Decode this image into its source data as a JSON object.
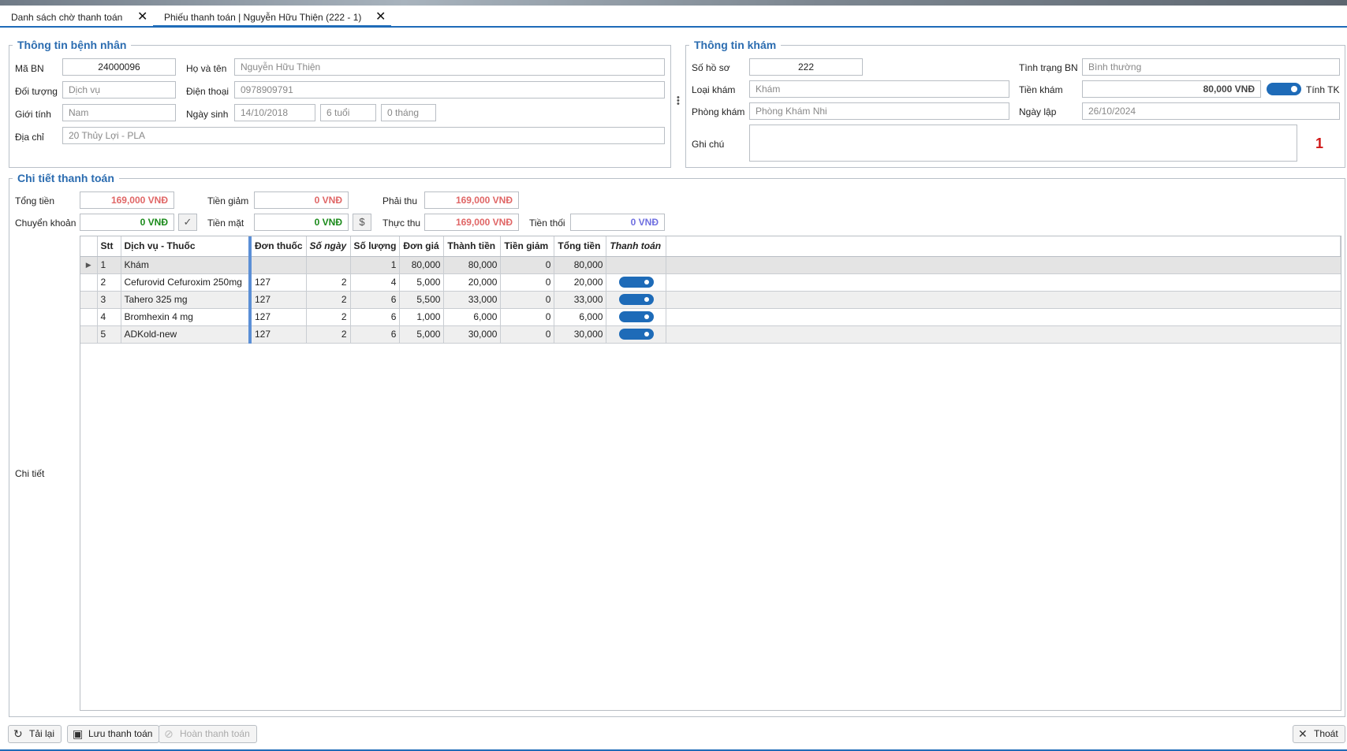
{
  "tabs": [
    {
      "label": "Danh sách chờ thanh toán",
      "close": "✕"
    },
    {
      "label": "Phiếu thanh toán | Nguyễn Hữu Thiện (222 - 1)",
      "close": "✕"
    }
  ],
  "patient": {
    "legend": "Thông tin bệnh nhân",
    "ma_bn_label": "Mã BN",
    "ma_bn": "24000096",
    "ho_ten_label": "Họ và tên",
    "ho_ten": "Nguyễn Hữu Thiện",
    "doi_tuong_label": "Đối tượng",
    "doi_tuong": "Dịch vụ",
    "dien_thoai_label": "Điện thoại",
    "dien_thoai": "0978909791",
    "gioi_tinh_label": "Giới tính",
    "gioi_tinh": "Nam",
    "ngay_sinh_label": "Ngày sinh",
    "ngay_sinh": "14/10/2018",
    "tuoi": "6 tuổi",
    "thang": "0 tháng",
    "dia_chi_label": "Địa chỉ",
    "dia_chi": "20 Thủy Lợi - PLA"
  },
  "exam": {
    "legend": "Thông tin khám",
    "so_ho_so_label": "Số hồ sơ",
    "so_ho_so": "222",
    "tinh_trang_label": "Tình trạng BN",
    "tinh_trang": "Bình thường",
    "loai_kham_label": "Loại khám",
    "loai_kham": "Khám",
    "tien_kham_label": "Tiền khám",
    "tien_kham": "80,000 VNĐ",
    "tinh_tk_label": "Tính TK",
    "phong_kham_label": "Phòng khám",
    "phong_kham": "Phòng Khám Nhi",
    "ngay_lap_label": "Ngày lập",
    "ngay_lap": "26/10/2024",
    "ghi_chu_label": "Ghi chú",
    "ghi_chu": "",
    "counter": "1"
  },
  "payment": {
    "legend": "Chi tiết thanh toán",
    "tong_tien_label": "Tổng tiền",
    "tong_tien": "169,000 VNĐ",
    "tien_giam_label": "Tiền giảm",
    "tien_giam": "0 VNĐ",
    "phai_thu_label": "Phải thu",
    "phai_thu": "169,000 VNĐ",
    "chuyen_khoan_label": "Chuyển khoản",
    "chuyen_khoan": "0 VNĐ",
    "tien_mat_label": "Tiền mặt",
    "tien_mat": "0 VNĐ",
    "thuc_thu_label": "Thực thu",
    "thuc_thu": "169,000 VNĐ",
    "tien_thoi_label": "Tiền thối",
    "tien_thoi": "0 VNĐ",
    "chi_tiet_label": "Chi tiết"
  },
  "table": {
    "columns": [
      "Stt",
      "Dịch vụ - Thuốc",
      "Đơn thuốc",
      "Số ngày",
      "Số lượng",
      "Đơn giá",
      "Thành tiền",
      "Tiền giảm",
      "Tổng tiền",
      "Thanh toán"
    ],
    "rows": [
      {
        "stt": "1",
        "name": "Khám",
        "don_thuoc": "",
        "so_ngay": "",
        "so_luong": "1",
        "don_gia": "80,000",
        "thanh_tien": "80,000",
        "tien_giam": "0",
        "tong_tien": "80,000",
        "paid": false
      },
      {
        "stt": "2",
        "name": "Cefurovid Cefuroxim 250mg",
        "don_thuoc": "127",
        "so_ngay": "2",
        "so_luong": "4",
        "don_gia": "5,000",
        "thanh_tien": "20,000",
        "tien_giam": "0",
        "tong_tien": "20,000",
        "paid": true
      },
      {
        "stt": "3",
        "name": "Tahero 325 mg",
        "don_thuoc": "127",
        "so_ngay": "2",
        "so_luong": "6",
        "don_gia": "5,500",
        "thanh_tien": "33,000",
        "tien_giam": "0",
        "tong_tien": "33,000",
        "paid": true
      },
      {
        "stt": "4",
        "name": "Bromhexin 4 mg",
        "don_thuoc": "127",
        "so_ngay": "2",
        "so_luong": "6",
        "don_gia": "1,000",
        "thanh_tien": "6,000",
        "tien_giam": "0",
        "tong_tien": "6,000",
        "paid": true
      },
      {
        "stt": "5",
        "name": "ADKold-new",
        "don_thuoc": "127",
        "so_ngay": "2",
        "so_luong": "6",
        "don_gia": "5,000",
        "thanh_tien": "30,000",
        "tien_giam": "0",
        "tong_tien": "30,000",
        "paid": true
      }
    ]
  },
  "buttons": {
    "reload": "Tải lại",
    "save": "Lưu thanh toán",
    "cancel_payment": "Hoàn thanh toán",
    "exit": "Thoát"
  }
}
